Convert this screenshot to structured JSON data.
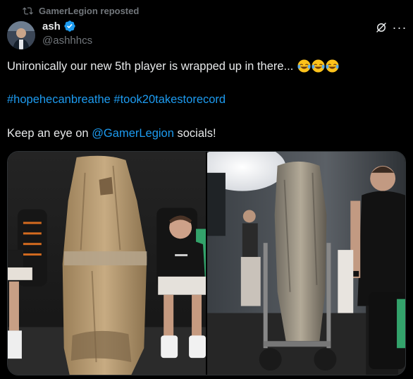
{
  "repost": {
    "text": "GamerLegion reposted",
    "icon": "repost-icon"
  },
  "author": {
    "display_name": "ash",
    "handle": "@ashhhcs",
    "verified": true,
    "verified_color": "#1d9bf0"
  },
  "actions": {
    "grok_icon": "grok-icon",
    "more_icon": "more-icon",
    "more_label": "···"
  },
  "post": {
    "line1": "Unironically our new 5th player is wrapped up in there...",
    "line1_emojis": [
      "face-with-tears-of-joy-emoji",
      "face-with-tears-of-joy-emoji",
      "face-with-tears-of-joy-emoji"
    ],
    "hashtag1": "#hopehecanbreathe",
    "hashtag2": "#took20takestorecord",
    "line3_prefix": "Keep an eye on ",
    "mention": "@GamerLegion",
    "line3_suffix": " socials!"
  },
  "media": [
    {
      "kind": "photo",
      "description_icon": "photo-left"
    },
    {
      "kind": "photo",
      "description_icon": "photo-right"
    }
  ],
  "colors": {
    "background": "#000000",
    "text": "#e7e9ea",
    "secondary": "#71767b",
    "link": "#1d9bf0"
  }
}
